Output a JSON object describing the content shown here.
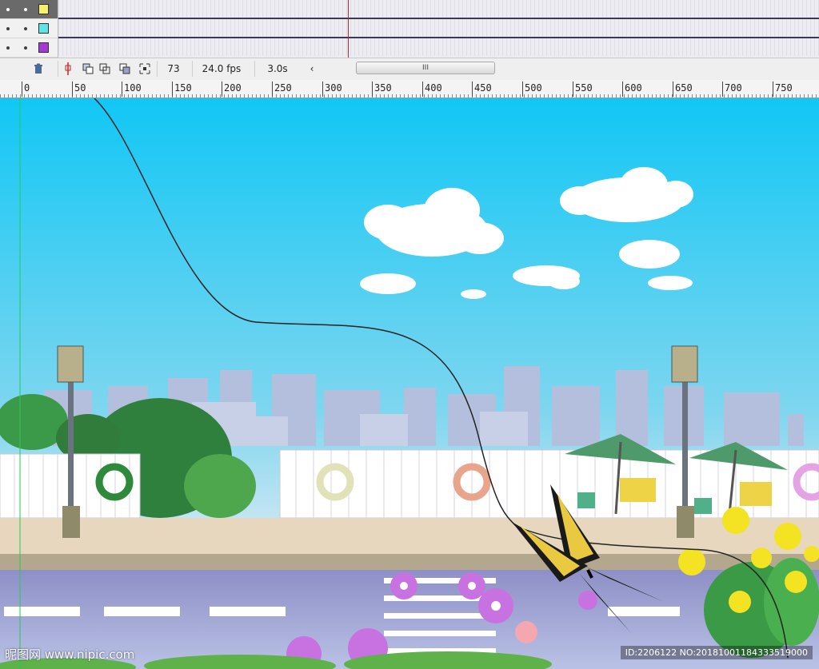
{
  "timeline": {
    "layers": [
      {
        "color": "#f7f06b",
        "selected": true
      },
      {
        "color": "#5fe3e3",
        "selected": false
      },
      {
        "color": "#a33ad6",
        "selected": false
      }
    ],
    "current_frame": "73",
    "fps": "24.0 fps",
    "time": "3.0s",
    "scroll_thumb_label": "III",
    "scroll_left_arrow": "‹"
  },
  "ruler": {
    "labels": [
      "0",
      "50",
      "100",
      "150",
      "200",
      "250",
      "300",
      "350",
      "400",
      "450",
      "500",
      "550",
      "600",
      "650",
      "700",
      "750"
    ]
  },
  "stage": {
    "watermark_left": "昵图网 www.nipic.com",
    "watermark_right": "ID:2206122 NO:20181001184333519000"
  },
  "icons": {
    "trash": "trash-icon",
    "onion": "onion-skin-icon",
    "edit_multiple": "edit-multiple-frames-icon",
    "modify_markers": "modify-onion-markers-icon",
    "center": "center-frame-icon"
  }
}
